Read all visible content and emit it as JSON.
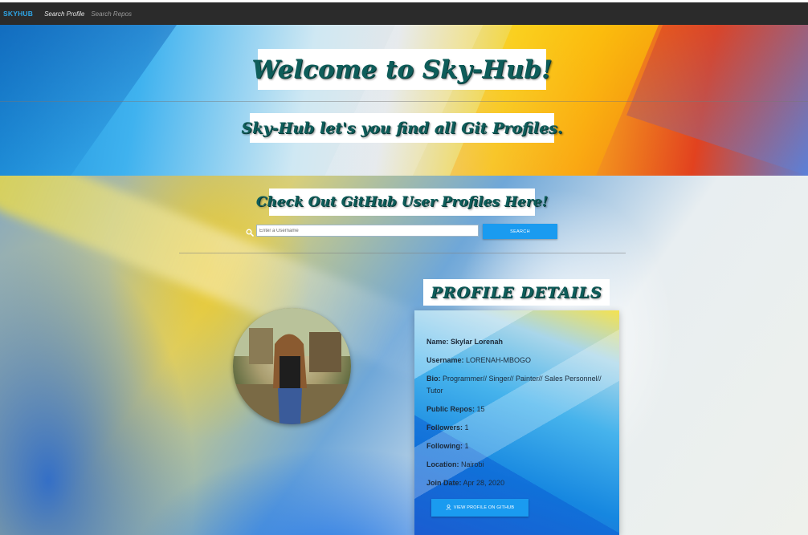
{
  "navbar": {
    "brand": "SKYHUB",
    "links": [
      "Search Profile",
      "Search Repos"
    ]
  },
  "hero": {
    "title": "Welcome to  Sky-Hub!",
    "tagline": "Sky-Hub let's you find all Git Profiles."
  },
  "search_section": {
    "title": "Check Out GitHub User Profiles Here!",
    "input_placeholder": "Enter a Username",
    "button_label": "SEARCH",
    "icon": "search-icon"
  },
  "profile": {
    "section_title": "PROFILE DETAILS",
    "avatar": "profile-photo",
    "fields": [
      {
        "label": "Name:",
        "value": "Skylar Lorenah"
      },
      {
        "label": "Username:",
        "value": "LORENAH-MBOGO"
      },
      {
        "label": "Bio:",
        "value": "Programmer// Singer// Painter// Sales Personnel// Tutor"
      },
      {
        "label": "Public Repos:",
        "value": "15"
      },
      {
        "label": "Followers:",
        "value": "1"
      },
      {
        "label": "Following:",
        "value": "1"
      },
      {
        "label": "Location:",
        "value": "Nairobi"
      },
      {
        "label": "Join Date:",
        "value": "Apr 28, 2020"
      }
    ],
    "github_button_label": "VIEW PROFILE ON GITHUB",
    "github_button_icon": "user-icon"
  },
  "colors": {
    "navbar_bg": "#2b2b2b",
    "brand": "#2ea6e8",
    "button_bg": "#1a9bf0",
    "title_text": "#0e5d5a"
  }
}
